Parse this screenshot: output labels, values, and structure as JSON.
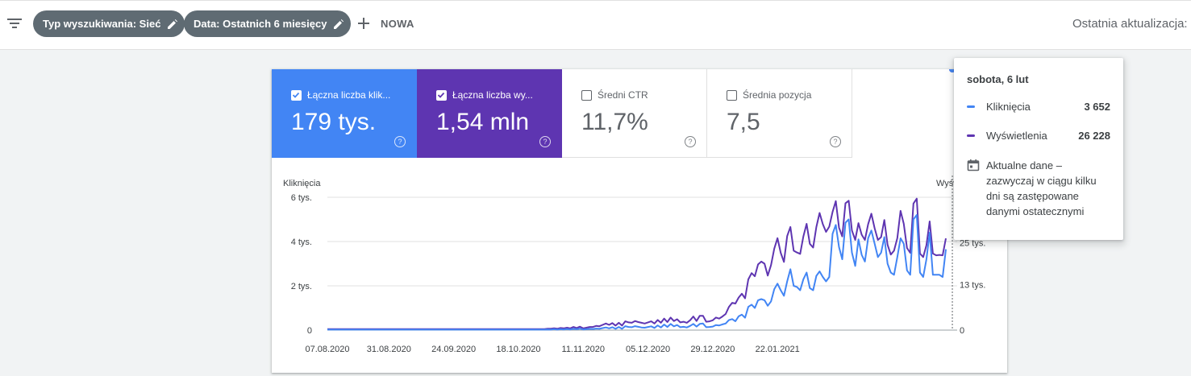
{
  "toolbar": {
    "filter_chips": [
      {
        "label": "Typ wyszukiwania: Sieć"
      },
      {
        "label": "Data: Ostatnich 6 miesięcy"
      }
    ],
    "new_label": "NOWA",
    "last_update_label": "Ostatnia aktualizacja:"
  },
  "metrics": [
    {
      "label": "Łączna liczba klik...",
      "value": "179 tys.",
      "checked": true,
      "color": "#4285f4"
    },
    {
      "label": "Łączna liczba wy...",
      "value": "1,54 mln",
      "checked": true,
      "color": "#5e35b1"
    },
    {
      "label": "Średni CTR",
      "value": "11,7%",
      "checked": false
    },
    {
      "label": "Średnia pozycja",
      "value": "7,5",
      "checked": false
    }
  ],
  "chart_data": {
    "type": "line",
    "left_axis_label": "Kliknięcia",
    "right_axis_label": "Wyświetlenia",
    "left_ticks": [
      "0",
      "2 tys.",
      "4 tys.",
      "6 tys."
    ],
    "right_ticks": [
      "0",
      "13 tys.",
      "25 tys."
    ],
    "ylim_left": [
      0,
      6000
    ],
    "ylim_right": [
      0,
      38000
    ],
    "x_tick_labels": [
      "07.08.2020",
      "31.08.2020",
      "24.09.2020",
      "18.10.2020",
      "11.11.2020",
      "05.12.2020",
      "29.12.2020",
      "22.01.2021"
    ],
    "series": [
      {
        "name": "Kliknięcia",
        "color": "#4285f4",
        "axis": "left",
        "values": [
          20,
          20,
          20,
          20,
          20,
          20,
          20,
          20,
          20,
          20,
          20,
          20,
          20,
          20,
          20,
          20,
          20,
          20,
          20,
          20,
          20,
          20,
          20,
          20,
          20,
          20,
          20,
          20,
          20,
          20,
          20,
          20,
          20,
          20,
          20,
          20,
          20,
          20,
          20,
          20,
          20,
          20,
          20,
          20,
          20,
          20,
          20,
          20,
          20,
          20,
          20,
          20,
          20,
          20,
          20,
          20,
          20,
          20,
          20,
          20,
          20,
          20,
          20,
          20,
          20,
          20,
          20,
          20,
          30,
          20,
          40,
          20,
          40,
          30,
          50,
          30,
          60,
          40,
          70,
          30,
          40,
          60,
          50,
          70,
          60,
          90,
          120,
          80,
          130,
          60,
          140,
          60,
          180,
          140,
          130,
          180,
          150,
          120,
          110,
          140,
          170,
          100,
          210,
          120,
          250,
          140,
          280,
          170,
          230,
          130,
          150,
          120,
          190,
          280,
          160,
          280,
          300,
          130,
          140,
          160,
          230,
          210,
          260,
          300,
          450,
          500,
          400,
          620,
          700,
          560,
          1050,
          1150,
          1000,
          1350,
          1400,
          1350,
          1100,
          1300,
          1850,
          2100,
          1800,
          1550,
          2200,
          2750,
          2000,
          1950,
          1800,
          2300,
          2600,
          1900,
          1800,
          2450,
          2650,
          2400,
          2200,
          2400,
          4350,
          4750,
          3750,
          3200,
          4850,
          5000,
          3500,
          2900,
          4100,
          3400,
          3100,
          4150,
          4500,
          3900,
          3300,
          3500,
          4200,
          3000,
          2600,
          2500,
          3300,
          4150,
          3900,
          2700,
          2500,
          5000,
          5200,
          2600,
          2400,
          3200,
          4400,
          2500,
          2500,
          2500,
          2400,
          3652
        ]
      },
      {
        "name": "Wyświetlenia",
        "color": "#5e35b1",
        "axis": "right",
        "values": [
          300,
          300,
          300,
          300,
          300,
          300,
          300,
          300,
          300,
          300,
          300,
          300,
          300,
          300,
          300,
          300,
          300,
          300,
          300,
          300,
          300,
          300,
          300,
          300,
          300,
          300,
          300,
          300,
          300,
          300,
          300,
          300,
          300,
          300,
          300,
          300,
          300,
          300,
          300,
          300,
          300,
          300,
          300,
          300,
          300,
          300,
          300,
          300,
          300,
          300,
          300,
          300,
          300,
          300,
          300,
          300,
          300,
          300,
          300,
          300,
          300,
          300,
          300,
          300,
          300,
          300,
          300,
          300,
          400,
          400,
          500,
          400,
          600,
          500,
          700,
          500,
          900,
          600,
          1000,
          500,
          700,
          900,
          900,
          1200,
          1100,
          1500,
          1900,
          1500,
          2000,
          1300,
          2100,
          1300,
          2500,
          2200,
          2100,
          2600,
          2300,
          2100,
          1900,
          2200,
          2500,
          1900,
          2900,
          2100,
          3300,
          2300,
          3600,
          2600,
          3100,
          2200,
          2400,
          2100,
          2800,
          3900,
          2600,
          4100,
          4100,
          2400,
          2500,
          2800,
          3600,
          3300,
          3900,
          4600,
          6600,
          7800,
          7600,
          9300,
          10400,
          9100,
          14500,
          16300,
          15400,
          18800,
          19600,
          19000,
          15600,
          18600,
          23300,
          26300,
          22100,
          19500,
          26900,
          29500,
          22700,
          22200,
          21800,
          26800,
          30400,
          24700,
          23600,
          29500,
          33500,
          30300,
          28100,
          29600,
          33800,
          36900,
          29300,
          26800,
          36300,
          37000,
          28500,
          25800,
          30600,
          27300,
          25800,
          30300,
          33300,
          29100,
          25800,
          26600,
          31500,
          24400,
          21600,
          22700,
          26300,
          34100,
          30400,
          23500,
          22100,
          36200,
          37600,
          21900,
          20900,
          24300,
          31100,
          21900,
          21400,
          21500,
          21400,
          26228
        ]
      }
    ],
    "highlighted_index": 193
  },
  "tooltip": {
    "date": "sobota, 6 lut",
    "rows": [
      {
        "label": "Kliknięcia",
        "value": "3 652",
        "color": "#4285f4"
      },
      {
        "label": "Wyświetlenia",
        "value": "26 228",
        "color": "#5e35b1"
      }
    ],
    "note": "Aktualne dane – zazwyczaj w ciągu kilku dni są zastępowane danymi ostatecznymi"
  }
}
